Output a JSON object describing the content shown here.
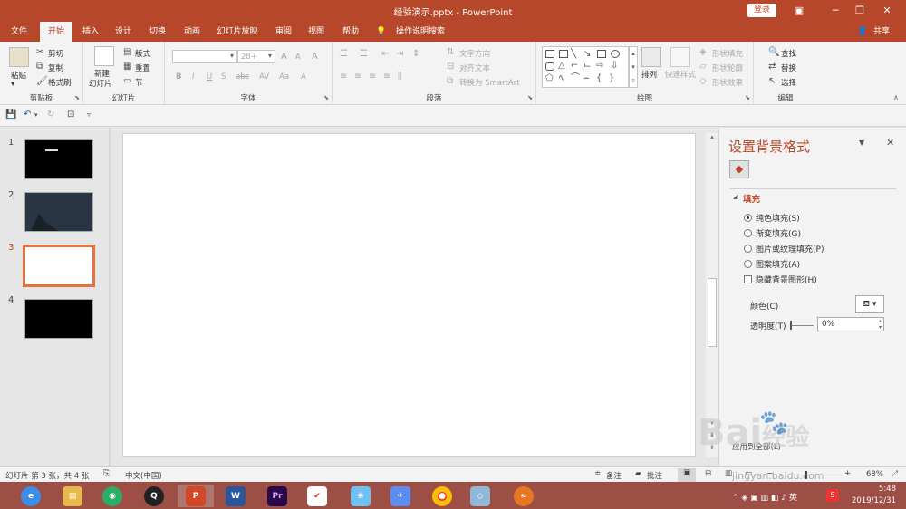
{
  "window": {
    "title": "经验演示.pptx - PowerPoint",
    "login_label": "登录",
    "minimize": "─",
    "restore": "❐",
    "close": "✕",
    "ribbon_display": "▣"
  },
  "tabs": [
    "文件",
    "开始",
    "插入",
    "设计",
    "切换",
    "动画",
    "幻灯片放映",
    "审阅",
    "视图",
    "帮助"
  ],
  "active_tab": "开始",
  "tell_me": "操作说明搜索",
  "share": "共享",
  "ribbon": {
    "clipboard": {
      "paste": "粘贴",
      "cut": "剪切",
      "copy": "复制",
      "format_painter": "格式刷",
      "label": "剪贴板"
    },
    "slides": {
      "new_slide_line1": "新建",
      "new_slide_line2": "幻灯片",
      "layout": "版式",
      "reset": "重置",
      "section": "节",
      "label": "幻灯片"
    },
    "font": {
      "font_name": "",
      "font_size": "28+",
      "bold": "B",
      "italic": "I",
      "underline": "U",
      "shadow": "S",
      "strike": "abc",
      "spacing": "AV",
      "case": "Aa",
      "color": "A",
      "grow": "A",
      "shrink": "A",
      "clear": "A",
      "label": "字体"
    },
    "paragraph": {
      "text_direction": "文字方向",
      "align_text": "对齐文本",
      "smartart": "转换为 SmartArt",
      "label": "段落"
    },
    "drawing": {
      "arrange": "排列",
      "quick_styles": "快速样式",
      "shape_fill": "形状填充",
      "shape_outline": "形状轮廓",
      "shape_effects": "形状效果",
      "label": "绘图"
    },
    "editing": {
      "find": "查找",
      "replace": "替换",
      "select": "选择",
      "label": "编辑"
    }
  },
  "slides_panel": {
    "slides": [
      {
        "number": "1",
        "bg": "#000000"
      },
      {
        "number": "2",
        "bg": "#2a3544"
      },
      {
        "number": "3",
        "bg": "#ffffff"
      },
      {
        "number": "4",
        "bg": "#000000"
      }
    ],
    "selected": "3"
  },
  "format_pane": {
    "title": "设置背景格式",
    "section_fill": "填充",
    "options": [
      "纯色填充(S)",
      "渐变填充(G)",
      "图片或纹理填充(P)",
      "图案填充(A)"
    ],
    "selected_option": "纯色填充(S)",
    "hide_bg_graphics": "隐藏背景图形(H)",
    "color_label": "颜色(C)",
    "transparency_label": "透明度(T)",
    "transparency_value": "0%",
    "apply_all": "应用到全部(L)",
    "accent": "#b7472a"
  },
  "status": {
    "slide_info": "幻灯片 第 3 张，共 4 张",
    "language": "中文(中国)",
    "notes": "备注",
    "comments": "批注",
    "zoom": "68%"
  },
  "taskbar": {
    "apps": [
      "360浏览器",
      "文件资源管理器",
      "微信",
      "QQ",
      "PowerPoint",
      "Word",
      "Premiere",
      "WPS",
      "图片",
      "飞书",
      "Chrome",
      "Visio",
      "其它"
    ],
    "active_app": "PowerPoint",
    "time": "5:48",
    "date": "2019/12/31"
  },
  "watermark": {
    "brand": "Bai",
    "brand2": "经验",
    "url": "jingyan.baidu.com"
  }
}
